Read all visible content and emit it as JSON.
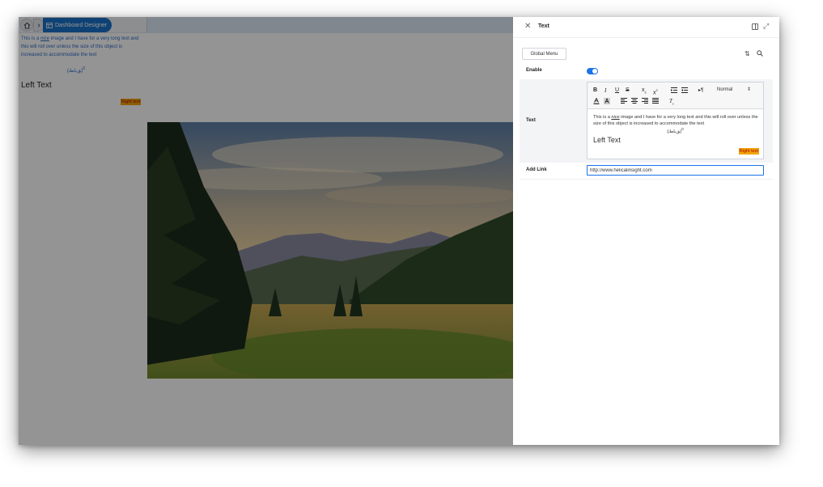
{
  "breadcrumb": {
    "active_label": "Dashboard Designer"
  },
  "canvas": {
    "long_text_before": "This is a ",
    "long_text_emph": "nice",
    "long_text_after": " image and I have for a very long text and this will roll over unless the size of this object is increased to accommodate the text",
    "arabic_text": "(ﻖﺑﺎﻄﺗ)",
    "arabic_sup": "0",
    "left_heading": "Left Text",
    "right_badge": "Right text"
  },
  "panel": {
    "title": "Text",
    "global_menu_label": "Global Menu",
    "enable_label": "Enable",
    "enable_on": true,
    "text_label": "Text",
    "add_link_label": "Add Link",
    "link_value": "http://www.helicalinsight.com"
  },
  "editor": {
    "toolbar": {
      "bold": "B",
      "italic": "I",
      "underline": "U",
      "strike": "S",
      "subscript_base": "x",
      "subscript_mark": "2",
      "superscript_base": "x",
      "superscript_mark": "2",
      "format_label": "Normal",
      "format_caret": "⇕",
      "direction": "▸¶",
      "clear": "T",
      "clear_mark": "x"
    },
    "content_before": "This is a ",
    "content_emph": "nice",
    "content_after": " image and I have for a very long text and this will roll over unless the size of this object is increased to accommodate the text",
    "content_arabic": "(ﻖﺑﺎﻄﺗ)",
    "content_arabic_sup": "0",
    "content_heading": "Left Text",
    "content_badge": "Right text"
  },
  "icons": {
    "close": "close-icon",
    "layout": "panel-layout-icon",
    "expand": "expand-icon",
    "sort": "sort-icon",
    "search": "search-icon",
    "home": "home-icon",
    "dashboard": "dashboard-icon"
  },
  "colors": {
    "accent": "#1a73e8",
    "breadcrumb_active": "#1a73c8",
    "badge_bg": "#f0a30a",
    "badge_text": "#b00000",
    "canvas_text": "#2e6bc3"
  }
}
